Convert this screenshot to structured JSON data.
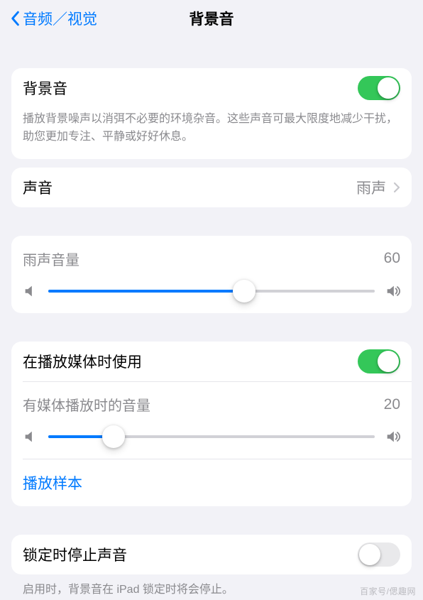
{
  "nav": {
    "back_label": "音频／视觉",
    "title": "背景音"
  },
  "main": {
    "toggle_label": "背景音",
    "toggle_on": true,
    "description": "播放背景噪声以消弭不必要的环境杂音。这些声音可最大限度地减少干扰，助您更加专注、平静或好好休息。"
  },
  "sound": {
    "label": "声音",
    "value": "雨声"
  },
  "volume1": {
    "label": "雨声音量",
    "value": 60
  },
  "media": {
    "toggle_label": "在播放媒体时使用",
    "toggle_on": true,
    "vol_label": "有媒体播放时的音量",
    "vol_value": 20,
    "sample_label": "播放样本"
  },
  "lock": {
    "toggle_label": "锁定时停止声音",
    "toggle_on": false,
    "footer": "启用时，背景音在 iPad 锁定时将会停止。"
  },
  "watermark": "百家号/偲趣网"
}
